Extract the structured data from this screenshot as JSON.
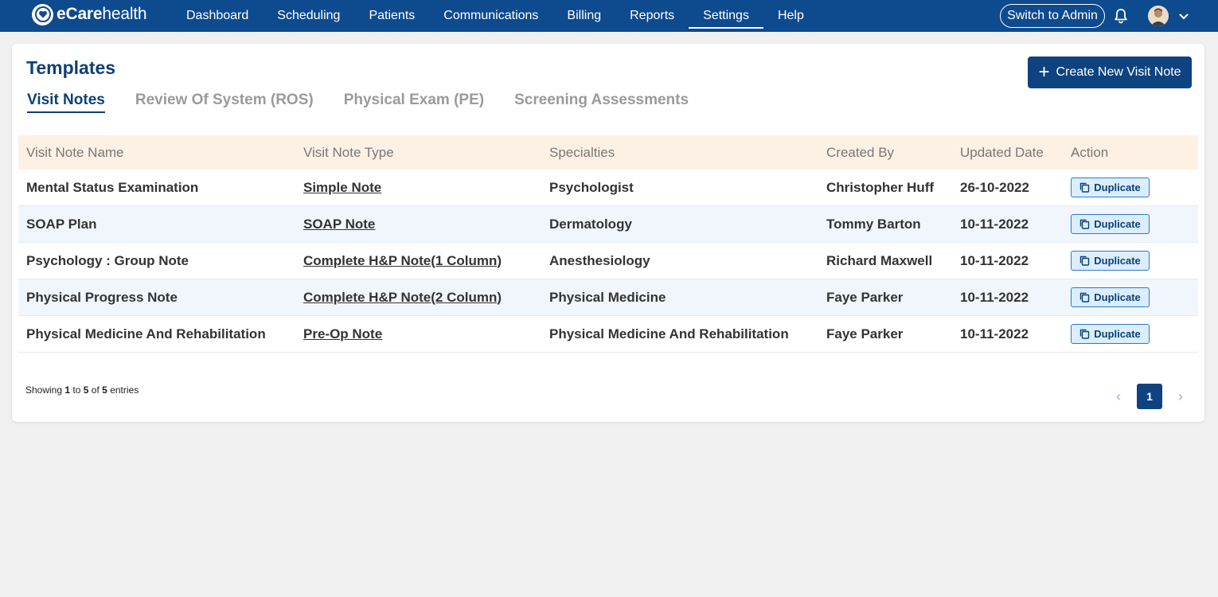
{
  "brand": {
    "name_bold": "eCare",
    "name_light": "health"
  },
  "nav": {
    "items": [
      {
        "label": "Dashboard"
      },
      {
        "label": "Scheduling"
      },
      {
        "label": "Patients"
      },
      {
        "label": "Communications"
      },
      {
        "label": "Billing"
      },
      {
        "label": "Reports"
      },
      {
        "label": "Settings",
        "active": true
      },
      {
        "label": "Help"
      }
    ],
    "switch_admin": "Switch to Admin",
    "icons": [
      "bell-icon",
      "avatar",
      "chevron-down-icon"
    ]
  },
  "page": {
    "title": "Templates",
    "create_button": "Create New Visit Note",
    "tabs": [
      {
        "label": "Visit Notes",
        "active": true
      },
      {
        "label": "Review Of System (ROS)"
      },
      {
        "label": "Physical Exam (PE)"
      },
      {
        "label": "Screening Assessments"
      }
    ]
  },
  "table": {
    "headers": [
      "Visit Note Name",
      "Visit Note Type",
      "Specialties",
      "Created By",
      "Updated Date",
      "Action"
    ],
    "rows": [
      {
        "name": "Mental Status Examination",
        "type": "Simple Note",
        "specialty": "Psychologist",
        "created_by": "Christopher Huff",
        "updated": "26-10-2022",
        "action": "Duplicate"
      },
      {
        "name": "SOAP Plan",
        "type": "SOAP Note",
        "specialty": "Dermatology",
        "created_by": "Tommy Barton",
        "updated": "10-11-2022",
        "action": "Duplicate"
      },
      {
        "name": "Psychology : Group Note",
        "type": "Complete H&P Note(1 Column)",
        "specialty": "Anesthesiology",
        "created_by": "Richard Maxwell",
        "updated": "10-11-2022",
        "action": "Duplicate"
      },
      {
        "name": "Physical Progress Note",
        "type": "Complete H&P Note(2 Column)",
        "specialty": "Physical Medicine",
        "created_by": "Faye Parker",
        "updated": "10-11-2022",
        "action": "Duplicate"
      },
      {
        "name": "Physical Medicine And Rehabilitation",
        "type": "Pre-Op Note",
        "specialty": "Physical Medicine And Rehabilitation",
        "created_by": "Faye Parker",
        "updated": "10-11-2022",
        "action": "Duplicate"
      }
    ]
  },
  "footer": {
    "showing_prefix": "Showing",
    "showing_from": "1",
    "showing_to_word": "to",
    "showing_to": "5",
    "showing_of_word": "of",
    "showing_total": "5",
    "showing_suffix": "entries",
    "current_page": "1",
    "prev": "‹",
    "next": "›"
  },
  "colors": {
    "navbar": "#0e4a8e",
    "primary": "#0e3f78",
    "header_row": "#fdf1e4",
    "alt_row": "#f1f6fc"
  }
}
